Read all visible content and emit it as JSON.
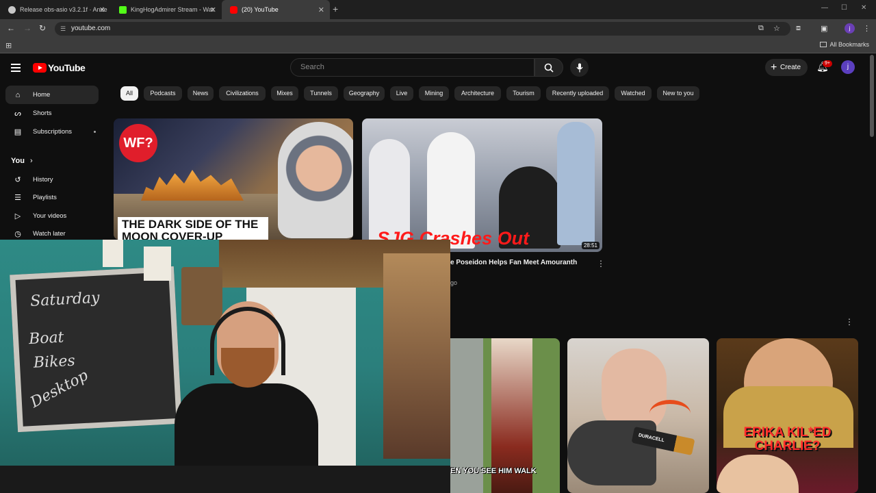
{
  "browser": {
    "tabs": [
      {
        "title": "Release obs-asio v3.2.1f · Ande",
        "favicon_color": "#c9c9c9"
      },
      {
        "title": "KingHogAdmirer Stream - Wat",
        "favicon_color": "#53fc18"
      },
      {
        "title": "(20) YouTube",
        "favicon_color": "#ff0000"
      }
    ],
    "url": "youtube.com",
    "profile_initial": "j",
    "bookmarks_label": "All Bookmarks"
  },
  "youtube": {
    "logo_text": "YouTube",
    "search_placeholder": "Search",
    "create_label": "Create",
    "notification_badge": "9+",
    "avatar_initial": "j",
    "sidebar": {
      "main": [
        {
          "label": "Home",
          "icon": "home-icon"
        },
        {
          "label": "Shorts",
          "icon": "shorts-icon"
        },
        {
          "label": "Subscriptions",
          "icon": "subscriptions-icon"
        }
      ],
      "you_label": "You",
      "you_items": [
        {
          "label": "History",
          "icon": "history-icon"
        },
        {
          "label": "Playlists",
          "icon": "playlists-icon"
        },
        {
          "label": "Your videos",
          "icon": "your-videos-icon"
        },
        {
          "label": "Watch later",
          "icon": "watch-later-icon"
        }
      ]
    },
    "chips": [
      "All",
      "Podcasts",
      "News",
      "Civilizations",
      "Mixes",
      "Tunnels",
      "Geography",
      "Live",
      "Mining",
      "Architecture",
      "Tourism",
      "Recently uploaded",
      "Watched",
      "New to you"
    ],
    "videos": [
      {
        "badge": "WF?",
        "thumb_text": "THE DARK SIDE OF THE MOON COVER-UP"
      },
      {
        "thumb_text": "SJG Crashes Out",
        "duration": "28:51",
        "title_partial": "e Poseidon Helps Fan Meet Amouranth",
        "meta_partial": "go"
      },
      {
        "thumb_text": "EN YOU SEE HIM WALK"
      },
      {
        "thumb_text": "DURACELL"
      },
      {
        "thumb_text": "ERIKA KIL*ED CHARLIE?"
      }
    ]
  },
  "webcam": {
    "chalkboard_words": [
      "Saturday",
      "Boat",
      "Bikes",
      "Desktop"
    ]
  }
}
